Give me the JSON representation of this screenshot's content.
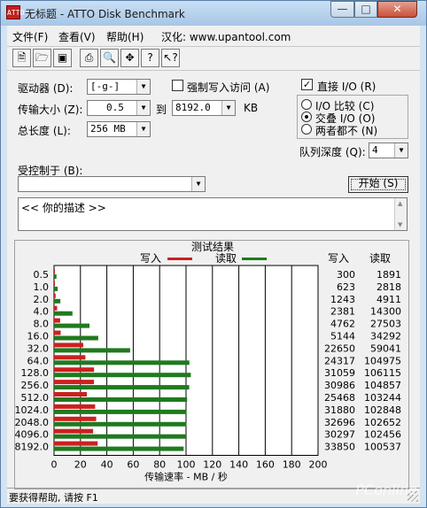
{
  "window": {
    "title": "无标题 - ATTO Disk Benchmark",
    "icon": "ATTO"
  },
  "menu": [
    "文件(F)",
    "查看(V)",
    "帮助(H)",
    "汉化: www.upantool.com"
  ],
  "toolbar_icons": [
    "new-icon",
    "open-icon",
    "save-icon",
    "print-icon",
    "print-preview-icon",
    "move-icon",
    "help-icon",
    "context-help-icon"
  ],
  "settings": {
    "drive_label": "驱动器 (D):",
    "drive_value": "[-g-]",
    "force_write_label": "强制写入访问 (A)",
    "transfer_label": "传输大小 (Z):",
    "transfer_from": "0.5",
    "to_label": "到",
    "transfer_to": "8192.0",
    "kb_label": "KB",
    "length_label": "总长度 (L):",
    "length_value": "256 MB",
    "direct_io_label": "直接 I/O (R)",
    "io_compare_label": "I/O 比较 (C)",
    "overlap_io_label": "交叠 I/O (O)",
    "neither_label": "两者都不 (N)",
    "queue_label": "队列深度 (Q):",
    "queue_value": "4",
    "controlled_label": "受控制于 (B):",
    "controlled_value": "",
    "start_button": "开始 (S)",
    "description": "<<   你的描述   >>"
  },
  "status": "要获得帮助, 请按 F1",
  "watermark": "PConline",
  "chart_data": {
    "type": "bar",
    "title": "测试结果",
    "xlabel": "传输速率 - MB / 秒",
    "orientation": "horizontal",
    "xlim": [
      0,
      200
    ],
    "x_ticks": [
      0,
      20,
      40,
      60,
      80,
      100,
      120,
      140,
      160,
      180,
      200
    ],
    "categories": [
      "0.5",
      "1.0",
      "2.0",
      "4.0",
      "8.0",
      "16.0",
      "32.0",
      "64.0",
      "128.0",
      "256.0",
      "512.0",
      "1024.0",
      "2048.0",
      "4096.0",
      "8192.0"
    ],
    "series": [
      {
        "name": "写入",
        "color": "#cc2020",
        "values": [
          0.29,
          0.61,
          1.21,
          2.33,
          4.65,
          5.02,
          22.13,
          23.75,
          30.33,
          30.26,
          24.87,
          31.13,
          31.93,
          29.59,
          33.06
        ]
      },
      {
        "name": "读取",
        "color": "#1f7a1f",
        "values": [
          1.85,
          2.75,
          4.8,
          13.96,
          26.86,
          33.49,
          57.66,
          102.52,
          103.62,
          102.4,
          100.82,
          100.44,
          100.25,
          100.05,
          98.18
        ]
      }
    ],
    "table": {
      "write_header": "写入",
      "read_header": "读取",
      "write": [
        "300",
        "623",
        "1243",
        "2381",
        "4762",
        "5144",
        "22650",
        "24317",
        "31059",
        "30986",
        "25468",
        "31880",
        "32696",
        "30297",
        "33850"
      ],
      "read": [
        "1891",
        "2818",
        "4911",
        "14300",
        "27503",
        "34292",
        "59041",
        "104975",
        "106115",
        "104857",
        "103244",
        "102848",
        "102652",
        "102456",
        "100537"
      ]
    }
  }
}
